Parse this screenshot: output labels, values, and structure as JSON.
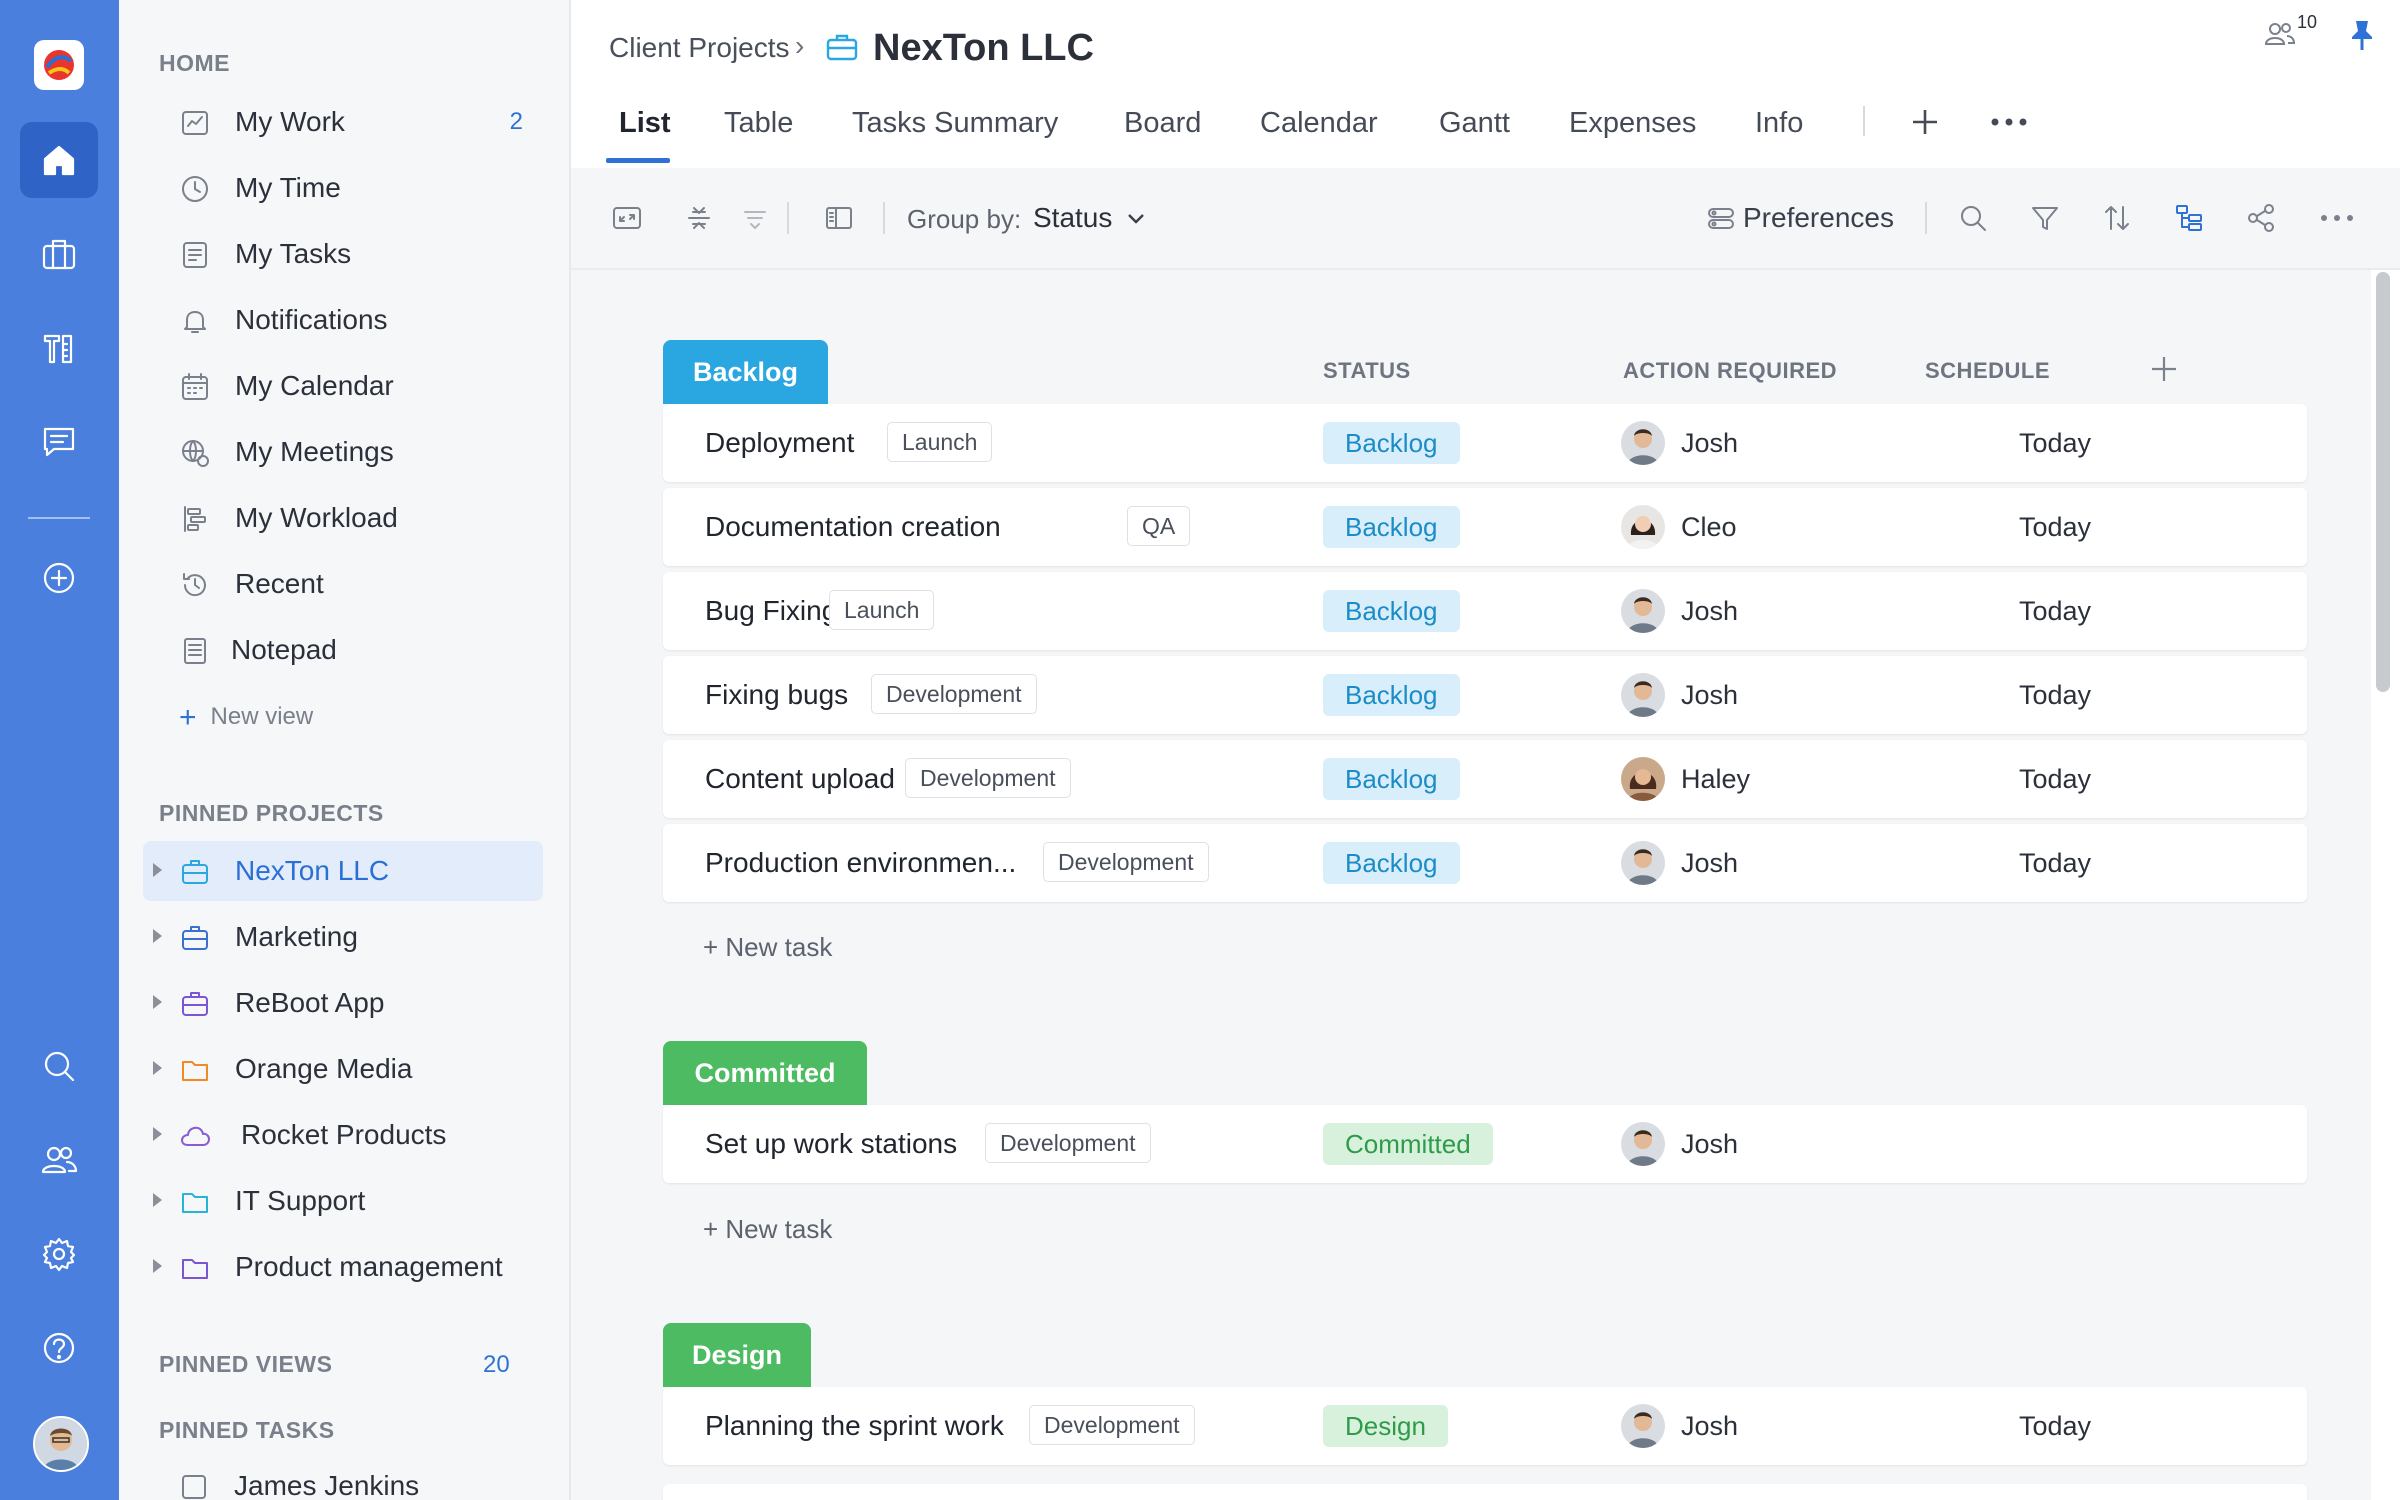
{
  "rail": {
    "items": [
      "home-icon",
      "briefcase-icon",
      "tools-icon",
      "chat-icon",
      "add-circle-icon",
      "search-icon",
      "people-icon",
      "gear-icon",
      "help-icon"
    ]
  },
  "sidebar": {
    "home_title": "HOME",
    "home_items": [
      {
        "label": "My Work",
        "count": "2",
        "icon": "my-work-icon"
      },
      {
        "label": "My Time",
        "icon": "clock-icon"
      },
      {
        "label": "My Tasks",
        "icon": "tasks-icon"
      },
      {
        "label": "Notifications",
        "icon": "bell-icon"
      },
      {
        "label": "My Calendar",
        "icon": "calendar-icon"
      },
      {
        "label": "My Meetings",
        "icon": "meetings-icon"
      },
      {
        "label": "My Workload",
        "icon": "workload-icon"
      },
      {
        "label": "Recent",
        "icon": "history-icon"
      },
      {
        "label": "Notepad",
        "icon": "notepad-icon"
      }
    ],
    "new_view": "New view",
    "pinned_projects_title": "PINNED PROJECTS",
    "projects": [
      {
        "label": "NexTon LLC",
        "icon": "briefcase-icon",
        "color": "#2aa7e0",
        "selected": true
      },
      {
        "label": "Marketing",
        "icon": "briefcase-icon",
        "color": "#3b6fd4"
      },
      {
        "label": "ReBoot App",
        "icon": "briefcase-icon",
        "color": "#7b55d6"
      },
      {
        "label": "Orange Media",
        "icon": "folder-icon",
        "color": "#f08a24"
      },
      {
        "label": "Rocket Products",
        "icon": "cloud-icon",
        "color": "#8a5bd6"
      },
      {
        "label": "IT Support",
        "icon": "folder-icon",
        "color": "#2ab3d9"
      },
      {
        "label": "Product management",
        "icon": "folder-icon",
        "color": "#7b55d6"
      }
    ],
    "pinned_views_title": "PINNED VIEWS",
    "pinned_views_count": "20",
    "pinned_tasks_title": "PINNED TASKS",
    "pinned_task_partial": "James Jenkins"
  },
  "header": {
    "breadcrumb": "Client Projects",
    "breadcrumb_sep": "›",
    "title": "NexTon LLC",
    "tabs": [
      "List",
      "Table",
      "Tasks Summary",
      "Board",
      "Calendar",
      "Gantt",
      "Expenses",
      "Info"
    ],
    "active_tab": "List",
    "members_count": "10"
  },
  "toolbar": {
    "group_by_label": "Group by:",
    "group_by_value": "Status",
    "preferences": "Preferences"
  },
  "columns": {
    "status": "STATUS",
    "action_required": "ACTION REQUIRED",
    "schedule": "SCHEDULE"
  },
  "groups": [
    {
      "name": "Backlog",
      "color": "#2aa7e0",
      "tasks": [
        {
          "name": "Deployment",
          "tag": "Launch",
          "status": "Backlog",
          "person": "Josh",
          "schedule": "Today"
        },
        {
          "name": "Documentation creation",
          "tag": "QA",
          "status": "Backlog",
          "person": "Cleo",
          "schedule": "Today"
        },
        {
          "name": "Bug Fixing",
          "tag": "Launch",
          "status": "Backlog",
          "person": "Josh",
          "schedule": "Today"
        },
        {
          "name": "Fixing bugs",
          "tag": "Development",
          "status": "Backlog",
          "person": "Josh",
          "schedule": "Today"
        },
        {
          "name": "Content upload",
          "tag": "Development",
          "status": "Backlog",
          "person": "Haley",
          "schedule": "Today"
        },
        {
          "name": "Production environmen...",
          "tag": "Development",
          "status": "Backlog",
          "person": "Josh",
          "schedule": "Today"
        }
      ],
      "new_task": "+ New task"
    },
    {
      "name": "Committed",
      "color": "#4cbb61",
      "tasks": [
        {
          "name": "Set up work stations",
          "tag": "Development",
          "status": "Committed",
          "person": "Josh",
          "schedule": ""
        }
      ],
      "new_task": "+ New task"
    },
    {
      "name": "Design",
      "color": "#4cbb61",
      "tasks": [
        {
          "name": "Planning the sprint work",
          "tag": "Development",
          "status": "Design",
          "person": "Josh",
          "schedule": "Today"
        }
      ]
    }
  ]
}
